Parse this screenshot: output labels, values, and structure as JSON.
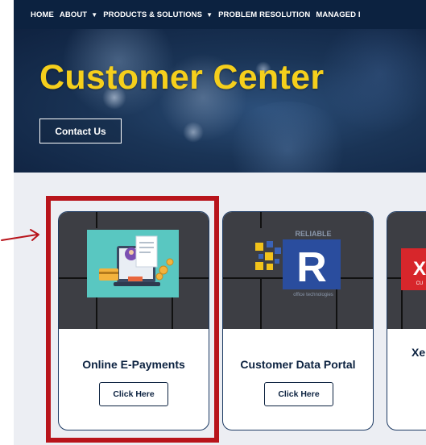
{
  "nav": {
    "items": [
      {
        "label": "HOME",
        "caret": false
      },
      {
        "label": "ABOUT",
        "caret": true
      },
      {
        "label": "PRODUCTS & SOLUTIONS",
        "caret": true
      },
      {
        "label": "PROBLEM RESOLUTION",
        "caret": false
      },
      {
        "label": "MANAGED I",
        "caret": false
      }
    ],
    "caret_glyph": "▼"
  },
  "hero": {
    "title": "Customer Center",
    "contact_label": "Contact Us"
  },
  "cards": [
    {
      "title": "Online E-Payments",
      "button": "Click Here"
    },
    {
      "title": "Customer Data Portal",
      "button": "Click Here",
      "logo_top_text": "RELIABLE",
      "logo_letter": "R",
      "logo_bottom_text": "office technologies"
    },
    {
      "title": "Xe",
      "logo_text": "X",
      "logo_sub": "CU"
    }
  ],
  "colors": {
    "nav_bg": "#0c2240",
    "title_yellow": "#f5cf1c",
    "highlight_red": "#b8141b",
    "card_border": "#1d3a63"
  }
}
